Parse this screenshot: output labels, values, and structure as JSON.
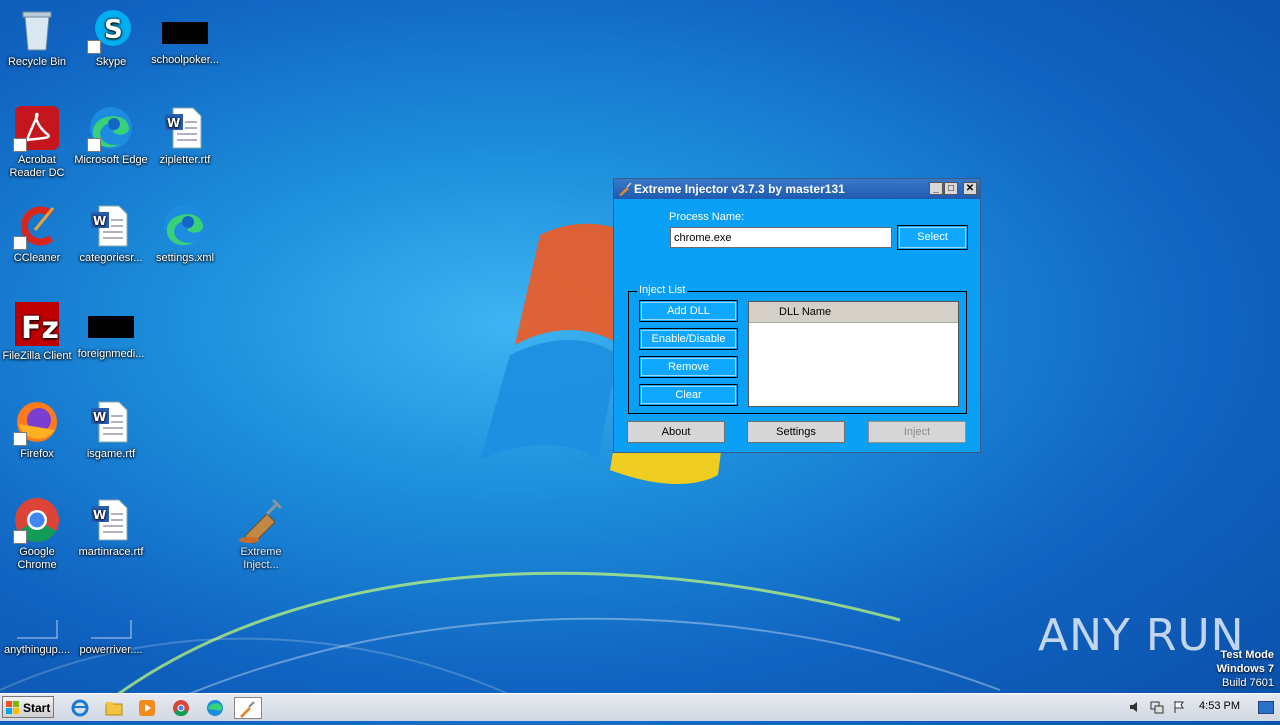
{
  "desktop": {
    "icons": [
      {
        "label": "Recycle Bin",
        "icon": "recycle-bin-icon"
      },
      {
        "label": "Skype",
        "icon": "skype-icon"
      },
      {
        "label": "schoolpoker...",
        "icon": "redacted-file-icon"
      },
      {
        "label": "Acrobat Reader DC",
        "icon": "acrobat-icon"
      },
      {
        "label": "Microsoft Edge",
        "icon": "edge-icon"
      },
      {
        "label": "zipletter.rtf",
        "icon": "word-doc-icon"
      },
      {
        "label": "CCleaner",
        "icon": "ccleaner-icon"
      },
      {
        "label": "categoriesr...",
        "icon": "word-doc-icon"
      },
      {
        "label": "settings.xml",
        "icon": "edge-icon"
      },
      {
        "label": "FileZilla Client",
        "icon": "filezilla-icon"
      },
      {
        "label": "foreignmedi...",
        "icon": "redacted-file-icon"
      },
      {
        "label": "Firefox",
        "icon": "firefox-icon"
      },
      {
        "label": "isgame.rtf",
        "icon": "word-doc-icon"
      },
      {
        "label": "Google Chrome",
        "icon": "chrome-icon"
      },
      {
        "label": "martinrace.rtf",
        "icon": "word-doc-icon"
      },
      {
        "label": "Extreme Inject...",
        "icon": "syringe-icon"
      },
      {
        "label": "anythingup....",
        "icon": "blank-file-icon"
      },
      {
        "label": "powerriver....",
        "icon": "blank-file-icon"
      }
    ]
  },
  "window": {
    "title": "Extreme Injector v3.7.3 by master131",
    "process_label": "Process Name:",
    "process_value": "chrome.exe",
    "select_label": "Select",
    "inject_list_label": "Inject List",
    "add_dll": "Add DLL",
    "enable_disable": "Enable/Disable",
    "remove": "Remove",
    "clear": "Clear",
    "dll_column": "DLL Name",
    "about": "About",
    "settings": "Settings",
    "inject": "Inject"
  },
  "watermark": {
    "brand": "ANY RUN"
  },
  "os_info": {
    "line1": "Test Mode",
    "line2": "Windows 7",
    "line3": "Build 7601"
  },
  "taskbar": {
    "start_label": "Start",
    "clock": "4:53 PM",
    "items": [
      "ie-icon",
      "explorer-icon",
      "media-player-icon",
      "chrome-icon",
      "edge-icon",
      "extreme-injector-icon"
    ]
  },
  "colors": {
    "window_bg": "#0aa0f5",
    "button_blue": "#10a8ff",
    "desktop": "#1d8fdc"
  }
}
